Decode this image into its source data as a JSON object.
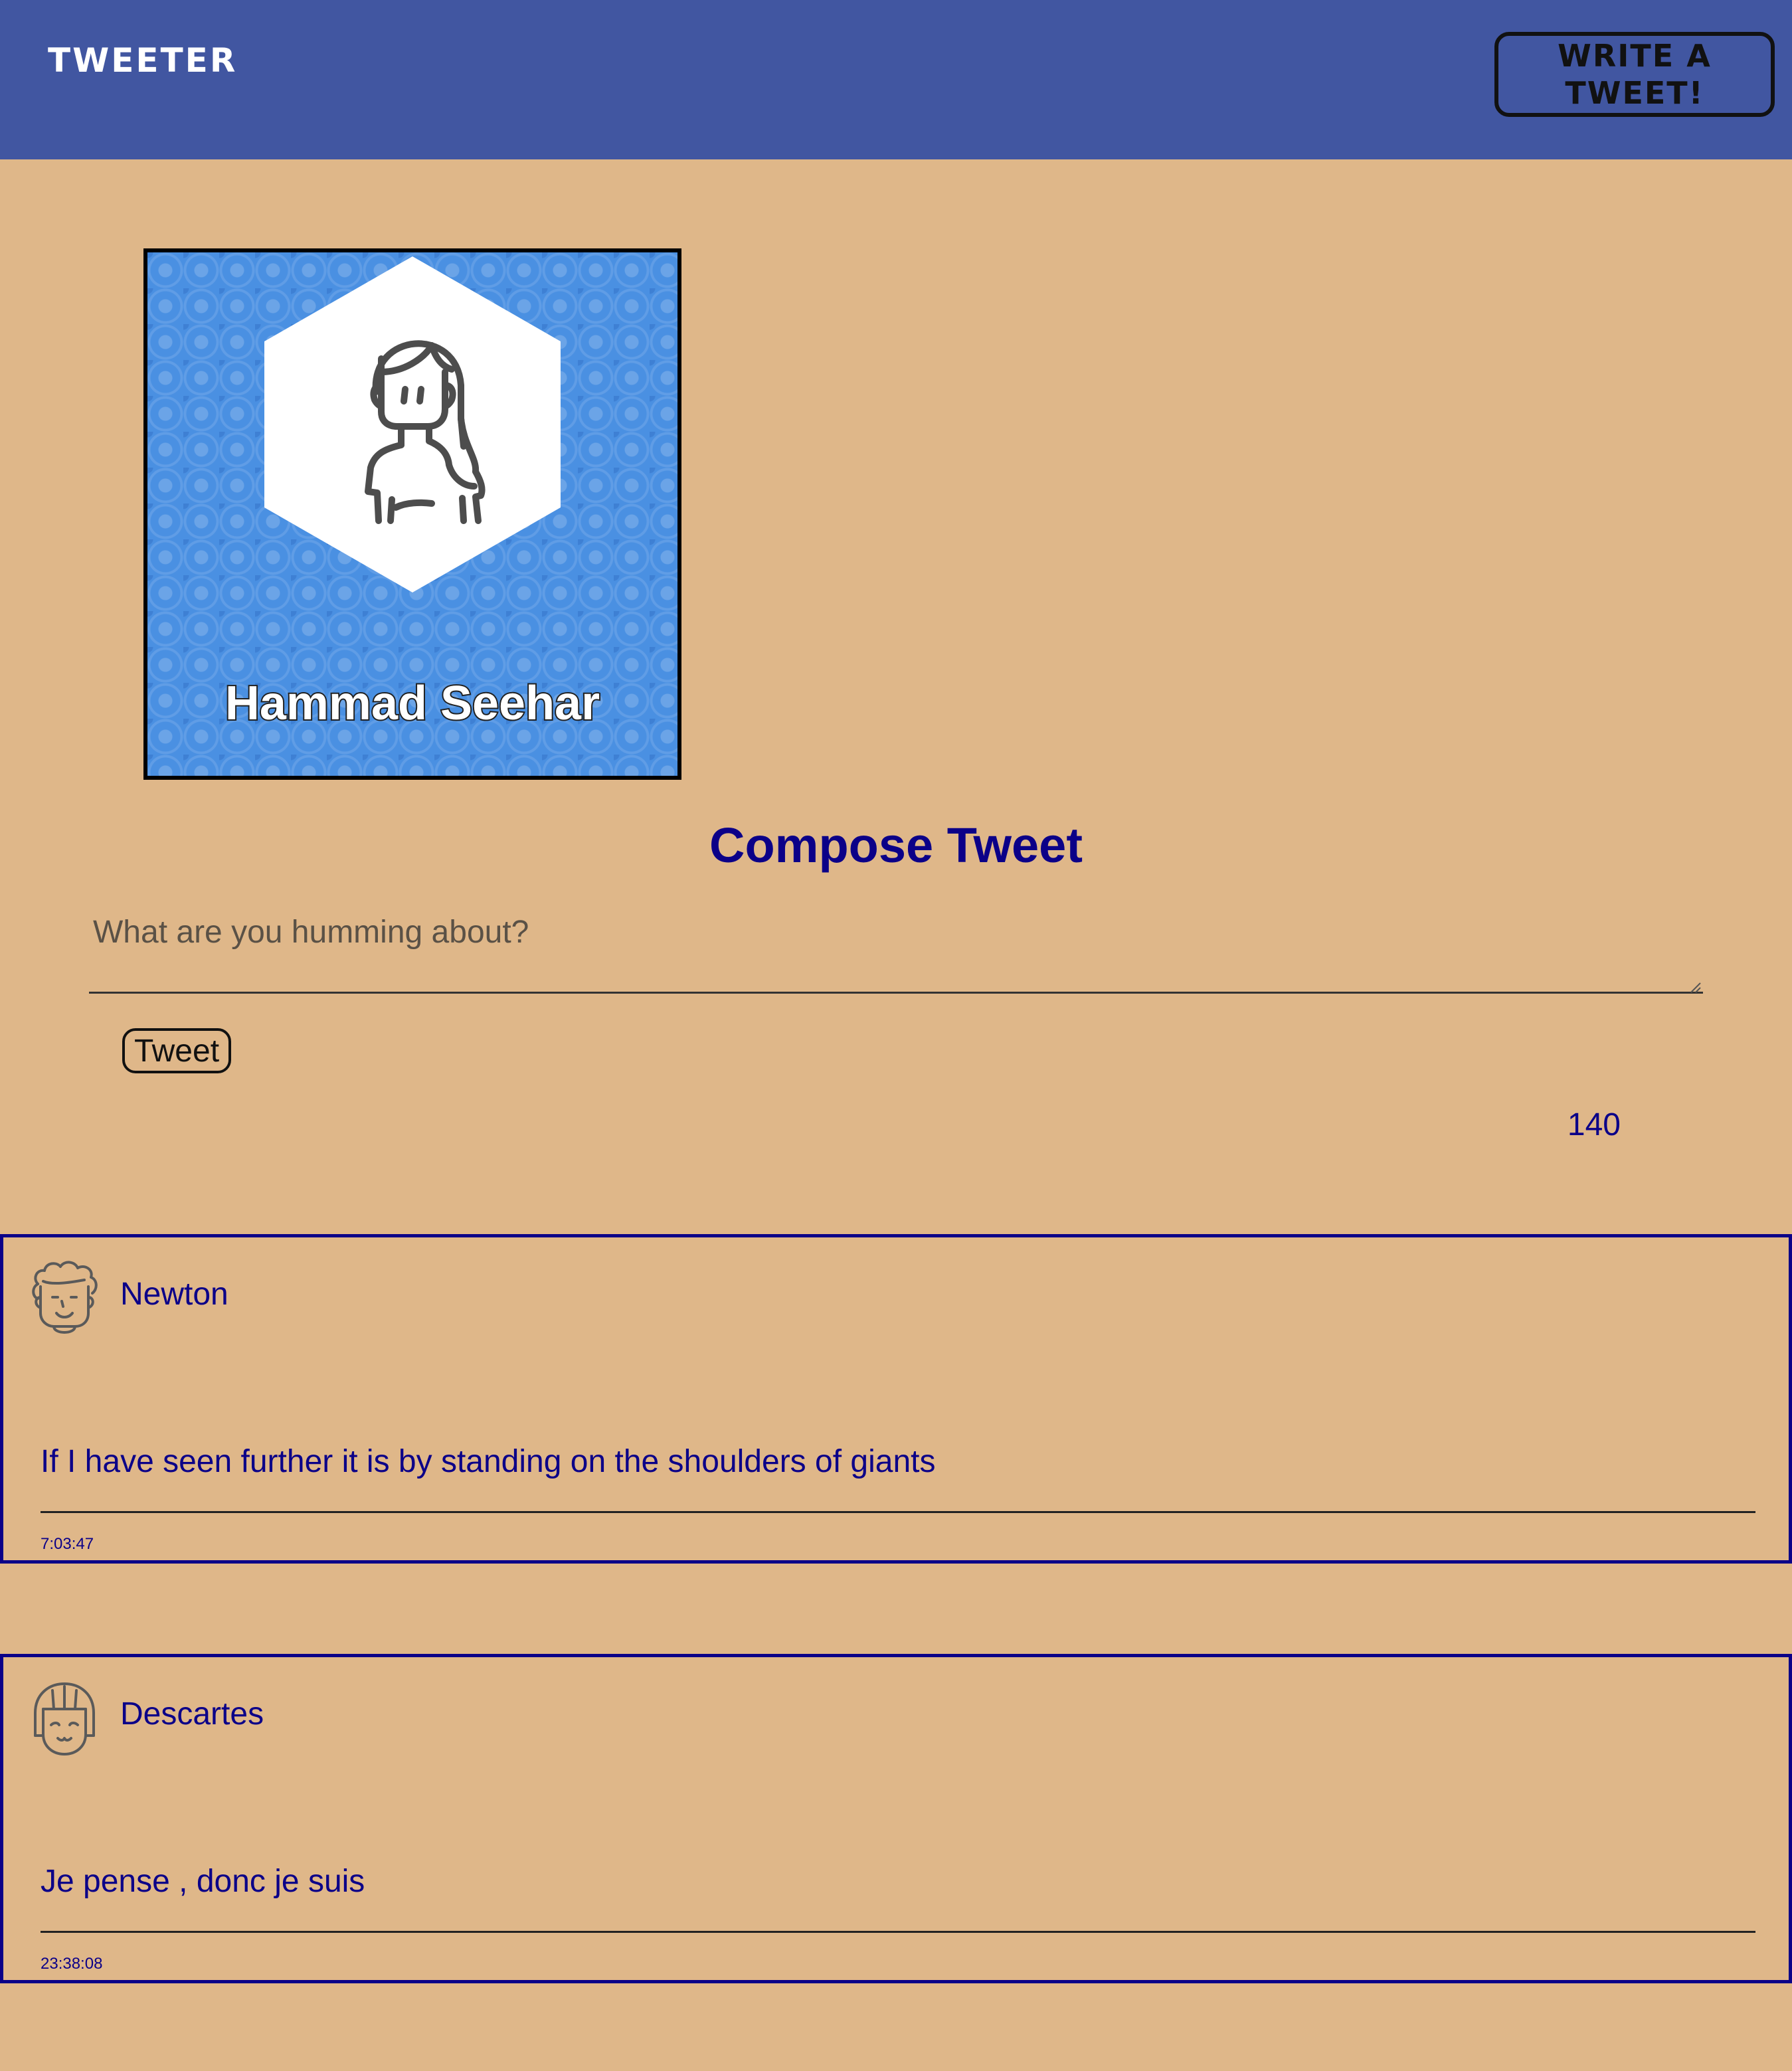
{
  "nav": {
    "brand": "TWEETER",
    "write_button": "WRITE A TWEET!",
    "background_color": "#4156A1"
  },
  "profile": {
    "name": "Hammad Seehar",
    "avatar_icon": "woman-avatar-icon",
    "card_color": "#4A90E2"
  },
  "compose": {
    "title": "Compose Tweet",
    "placeholder": "What are you humming about?",
    "value": "",
    "button_label": "Tweet",
    "char_counter": "140"
  },
  "tweets": [
    {
      "author": "Newton",
      "avatar_icon": "curly-hair-face-icon",
      "text": "If I have seen further it is by standing on the shoulders of giants",
      "time": "7:03:47"
    },
    {
      "author": "Descartes",
      "avatar_icon": "bob-hair-face-icon",
      "text": "Je pense , donc je suis",
      "time": "23:38:08"
    }
  ],
  "colors": {
    "page_background": "#DFB789",
    "accent_text": "#0B0088"
  }
}
